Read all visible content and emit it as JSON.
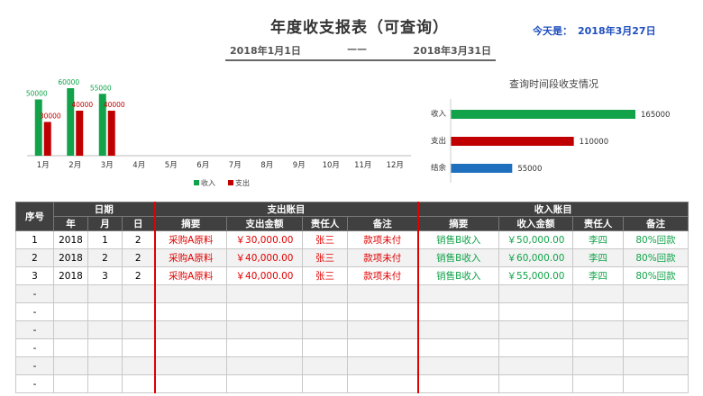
{
  "header": {
    "title": "年度收支报表（可查询）",
    "today_label": "今天是：",
    "today_value": "2018年3月27日",
    "start_date": "2018年1月1日",
    "separator": "——",
    "end_date": "2018年3月31日"
  },
  "chart_data": [
    {
      "type": "bar",
      "categories": [
        "1月",
        "2月",
        "3月",
        "4月",
        "5月",
        "6月",
        "7月",
        "8月",
        "9月",
        "10月",
        "11月",
        "12月"
      ],
      "series": [
        {
          "name": "收入",
          "values": [
            50000,
            60000,
            55000,
            null,
            null,
            null,
            null,
            null,
            null,
            null,
            null,
            null
          ],
          "color": "#12a34a"
        },
        {
          "name": "支出",
          "values": [
            30000,
            40000,
            40000,
            null,
            null,
            null,
            null,
            null,
            null,
            null,
            null,
            null
          ],
          "color": "#c00000"
        }
      ],
      "data_labels": [
        "50000",
        "60000",
        "55000",
        "30000",
        "40000",
        "40000"
      ],
      "ylim": [
        0,
        65000
      ],
      "legend": "bottom"
    },
    {
      "type": "bar",
      "orientation": "horizontal",
      "title": "查询时间段收支情况",
      "categories": [
        "收入",
        "支出",
        "结余"
      ],
      "values": [
        165000,
        110000,
        55000
      ],
      "value_labels": [
        "165000",
        "110000",
        "55000"
      ],
      "colors": [
        "#12a34a",
        "#c00000",
        "#1f6fbf"
      ],
      "xlim": [
        0,
        200000
      ]
    }
  ],
  "table": {
    "h_index": "序号",
    "h_date": "日期",
    "h_expense": "支出账目",
    "h_income": "收入账目",
    "h_year": "年",
    "h_month": "月",
    "h_day": "日",
    "h_exp_summary": "摘要",
    "h_exp_amount": "支出金额",
    "h_exp_person": "责任人",
    "h_exp_note": "备注",
    "h_inc_summary": "摘要",
    "h_inc_amount": "收入金额",
    "h_inc_person": "责任人",
    "h_inc_note": "备注",
    "rows": [
      {
        "idx": "1",
        "y": "2018",
        "m": "1",
        "d": "2",
        "es": "采购A原料",
        "ea": "￥30,000.00",
        "ep": "张三",
        "en": "款项未付",
        "is": "销售B收入",
        "ia": "￥50,000.00",
        "ip": "李四",
        "in": "80%回款"
      },
      {
        "idx": "2",
        "y": "2018",
        "m": "2",
        "d": "2",
        "es": "采购A原料",
        "ea": "￥40,000.00",
        "ep": "张三",
        "en": "款项未付",
        "is": "销售B收入",
        "ia": "￥60,000.00",
        "ip": "李四",
        "in": "80%回款"
      },
      {
        "idx": "3",
        "y": "2018",
        "m": "3",
        "d": "2",
        "es": "采购A原料",
        "ea": "￥40,000.00",
        "ep": "张三",
        "en": "款项未付",
        "is": "销售B收入",
        "ia": "￥55,000.00",
        "ip": "李四",
        "in": "80%回款"
      },
      {
        "idx": "-",
        "y": "",
        "m": "",
        "d": "",
        "es": "",
        "ea": "",
        "ep": "",
        "en": "",
        "is": "",
        "ia": "",
        "ip": "",
        "in": ""
      },
      {
        "idx": "-",
        "y": "",
        "m": "",
        "d": "",
        "es": "",
        "ea": "",
        "ep": "",
        "en": "",
        "is": "",
        "ia": "",
        "ip": "",
        "in": ""
      },
      {
        "idx": "-",
        "y": "",
        "m": "",
        "d": "",
        "es": "",
        "ea": "",
        "ep": "",
        "en": "",
        "is": "",
        "ia": "",
        "ip": "",
        "in": ""
      },
      {
        "idx": "-",
        "y": "",
        "m": "",
        "d": "",
        "es": "",
        "ea": "",
        "ep": "",
        "en": "",
        "is": "",
        "ia": "",
        "ip": "",
        "in": ""
      },
      {
        "idx": "-",
        "y": "",
        "m": "",
        "d": "",
        "es": "",
        "ea": "",
        "ep": "",
        "en": "",
        "is": "",
        "ia": "",
        "ip": "",
        "in": ""
      },
      {
        "idx": "-",
        "y": "",
        "m": "",
        "d": "",
        "es": "",
        "ea": "",
        "ep": "",
        "en": "",
        "is": "",
        "ia": "",
        "ip": "",
        "in": ""
      }
    ]
  }
}
